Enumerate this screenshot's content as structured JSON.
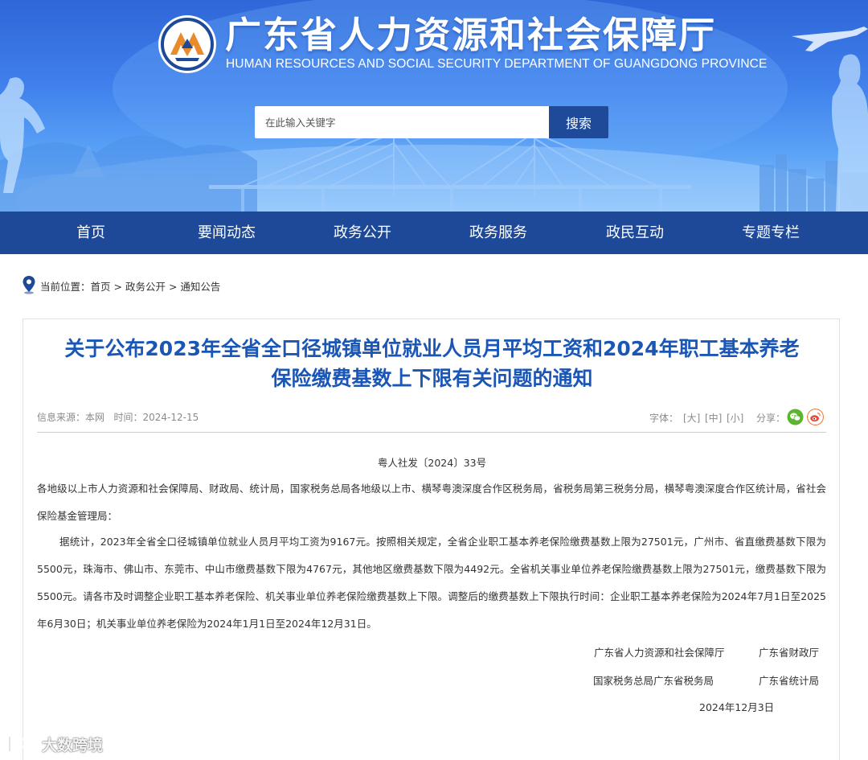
{
  "site": {
    "title": "广东省人力资源和社会保障厅",
    "subtitle": "HUMAN RESOURCES AND SOCIAL SECURITY DEPARTMENT OF GUANGDONG PROVINCE",
    "emblem_icon": "hr-department-emblem"
  },
  "search": {
    "placeholder": "在此输入关键字",
    "button_label": "搜索"
  },
  "nav": {
    "items": [
      "首页",
      "要闻动态",
      "政务公开",
      "政务服务",
      "政民互动",
      "专题专栏"
    ]
  },
  "breadcrumb": {
    "label": "当前位置：",
    "items": [
      "首页",
      "政务公开",
      "通知公告"
    ],
    "separator": " > "
  },
  "article": {
    "title_line1": "关于公布2023年全省全口径城镇单位就业人员月平均工资和2024年职工基本养老",
    "title_line2": "保险缴费基数上下限有关问题的通知",
    "meta": {
      "source_label": "信息来源：",
      "source": "本网",
      "time_label": "时间：",
      "time": "2024-12-15",
      "font_label": "字体：",
      "font_large": "[大]",
      "font_medium": "[中]",
      "font_small": "[小]",
      "share_label": "分享："
    },
    "doc_number": "粤人社发〔2024〕33号",
    "addressees": "各地级以上市人力资源和社会保障局、财政局、统计局，国家税务总局各地级以上市、横琴粤澳深度合作区税务局，省税务局第三税务分局，横琴粤澳深度合作区统计局，省社会保险基金管理局：",
    "paragraph": "据统计，2023年全省全口径城镇单位就业人员月平均工资为9167元。按照相关规定，全省企业职工基本养老保险缴费基数上限为27501元，广州市、省直缴费基数下限为5500元，珠海市、佛山市、东莞市、中山市缴费基数下限为4767元，其他地区缴费基数下限为4492元。全省机关事业单位养老保险缴费基数上限为27501元，缴费基数下限为5500元。请各市及时调整企业职工基本养老保险、机关事业单位养老保险缴费基数上下限。调整后的缴费基数上下限执行时间：企业职工基本养老保险为2024年7月1日至2025年6月30日；机关事业单位养老保险为2024年1月1日至2024年12月31日。",
    "signatures": {
      "org1": "广东省人力资源和社会保障厅",
      "org2": "广东省财政厅",
      "org3": "国家税务总局广东省税务局",
      "org4": "广东省统计局",
      "date": "2024年12月3日"
    }
  },
  "watermark": {
    "text": "大数跨境"
  },
  "colors": {
    "nav_bg": "#1e4998",
    "title_blue": "#1a56b5",
    "search_button": "#1f4a9a",
    "wechat_green": "#5cb531",
    "weibo_orange": "#f07a3c"
  }
}
